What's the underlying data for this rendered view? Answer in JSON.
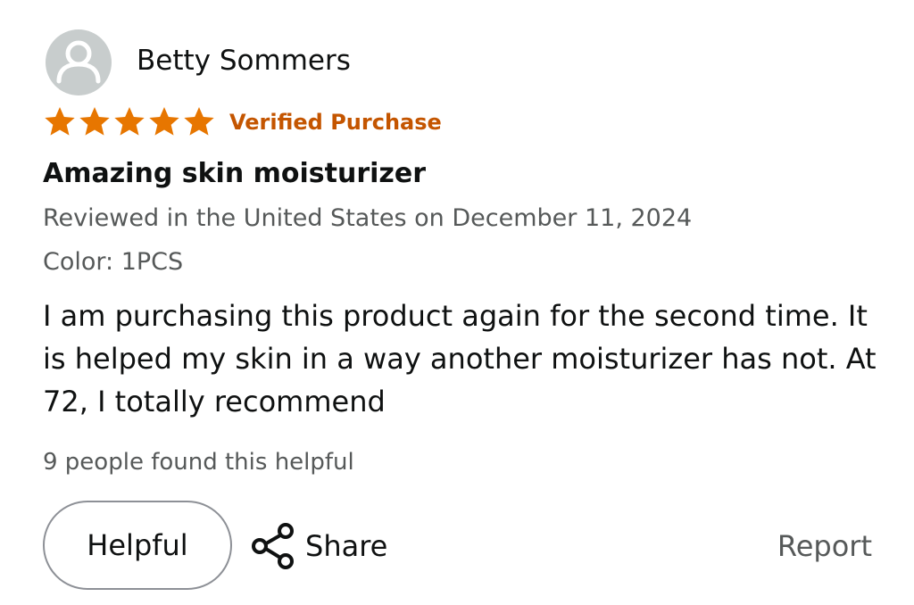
{
  "reviewer": {
    "name": "Betty Sommers"
  },
  "rating": {
    "stars": 5,
    "max": 5,
    "star_color": "#e77600"
  },
  "badge": {
    "verified_label": "Verified Purchase",
    "color": "#c45500"
  },
  "review": {
    "title": "Amazing skin moisturizer",
    "meta": "Reviewed in the United States on December 11, 2024",
    "variant": "Color: 1PCS",
    "body": "I am purchasing this product again for the second time. It is helped my skin in a way another moisturizer has not. At 72, I totally recommend",
    "helpful_count_text": "9 people found this helpful"
  },
  "actions": {
    "helpful_label": "Helpful",
    "share_label": "Share",
    "report_label": "Report"
  },
  "icons": {
    "avatar": "user-avatar-icon",
    "star": "star-icon",
    "share": "share-icon"
  }
}
